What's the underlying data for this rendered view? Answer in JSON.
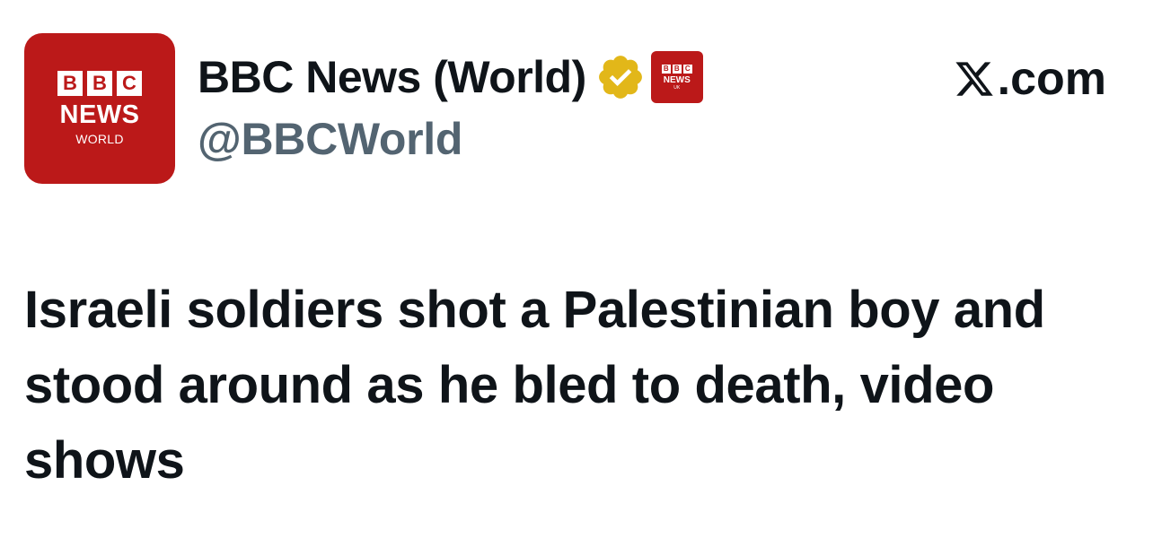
{
  "account": {
    "avatar": {
      "letters": [
        "B",
        "B",
        "C"
      ],
      "news": "NEWS",
      "sub": "WORLD",
      "color": "#bb1919"
    },
    "display_name": "BBC News (World)",
    "verified_badge_icon": "gold-verified-check-icon",
    "affiliate_badge": {
      "letters": [
        "B",
        "B",
        "C"
      ],
      "news": "NEWS",
      "sub": "UK"
    },
    "handle": "@BBCWorld"
  },
  "source": {
    "logo_icon": "x-logo-icon",
    "text": ".com"
  },
  "post": {
    "text": "Israeli soldiers shot a Palestinian boy and stood around as he bled to death, video shows"
  },
  "colors": {
    "bbc_red": "#bb1919",
    "verified_gold": "#e2b719",
    "handle_gray": "#536471",
    "text": "#0f1419"
  }
}
